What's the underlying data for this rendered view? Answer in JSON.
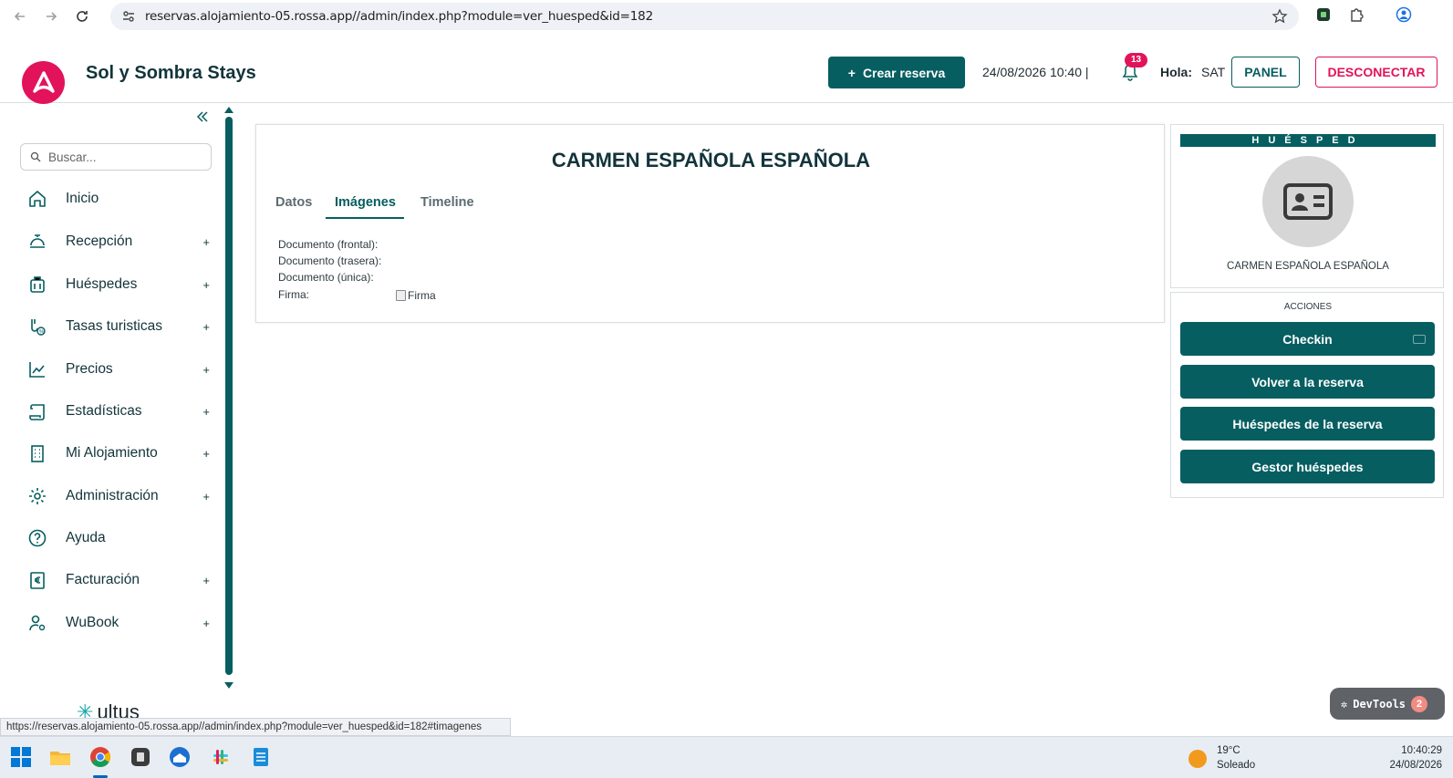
{
  "browser": {
    "url": "reservas.alojamiento-05.rossa.app//admin/index.php?module=ver_huesped&id=182",
    "status_url": "https://reservas.alojamiento-05.rossa.app//admin/index.php?module=ver_huesped&id=182#timagenes"
  },
  "header": {
    "brand": "Sol y Sombra Stays",
    "create_label": "Crear reserva",
    "datetime": "24/08/2026 10:40 |",
    "notifications_count": "13",
    "greeting": "Hola:",
    "user": "SAT",
    "panel_label": "PANEL",
    "logout_label": "DESCONECTAR"
  },
  "sidebar": {
    "search_placeholder": "Buscar...",
    "items": [
      {
        "label": "Inicio",
        "icon": "home-icon",
        "expandable": false,
        "plus": ""
      },
      {
        "label": "Recepción",
        "icon": "bell-desk-icon",
        "expandable": true,
        "plus": "+"
      },
      {
        "label": "Huéspedes",
        "icon": "luggage-icon",
        "expandable": true,
        "plus": "+"
      },
      {
        "label": "Tasas turisticas",
        "icon": "tax-icon",
        "expandable": true,
        "plus": "+"
      },
      {
        "label": "Precios",
        "icon": "chart-line-icon",
        "expandable": true,
        "plus": "+"
      },
      {
        "label": "Estadísticas",
        "icon": "scroll-icon",
        "expandable": true,
        "plus": "+"
      },
      {
        "label": "Mi Alojamiento",
        "icon": "building-icon",
        "expandable": true,
        "plus": "+"
      },
      {
        "label": "Administración",
        "icon": "gear-icon",
        "expandable": true,
        "plus": "+"
      },
      {
        "label": "Ayuda",
        "icon": "help-icon",
        "expandable": false,
        "plus": ""
      },
      {
        "label": "Facturación",
        "icon": "euro-receipt-icon",
        "expandable": true,
        "plus": "+"
      },
      {
        "label": "WuBook",
        "icon": "user-gear-icon",
        "expandable": true,
        "plus": "+"
      }
    ],
    "footer_logo_text": "ultus"
  },
  "guest": {
    "name": "CARMEN ESPAÑOLA ESPAÑOLA",
    "tabs": [
      {
        "label": "Datos",
        "active": false
      },
      {
        "label": "Imágenes",
        "active": true
      },
      {
        "label": "Timeline",
        "active": false
      }
    ],
    "documents": [
      {
        "label": "Documento (frontal):"
      },
      {
        "label": "Documento (trasera):"
      },
      {
        "label": "Documento (única):"
      },
      {
        "label": "Firma:"
      }
    ],
    "firma_alt": "Firma"
  },
  "right_panel": {
    "heading": "HUÉSPED",
    "name": "CARMEN ESPAÑOLA ESPAÑOLA",
    "actions_label": "ACCIONES",
    "actions": [
      "Checkin",
      "Volver a la reserva",
      "Huéspedes de la reserva",
      "Gestor huéspedes"
    ]
  },
  "devtools": {
    "label": "DevTools",
    "count": "2"
  },
  "taskbar": {
    "temperature": "19°C",
    "weather": "Soleado",
    "time": "10:40:29",
    "date": "24/08/2026"
  },
  "colors": {
    "primary": "#065e61",
    "accent": "#e2135a"
  }
}
